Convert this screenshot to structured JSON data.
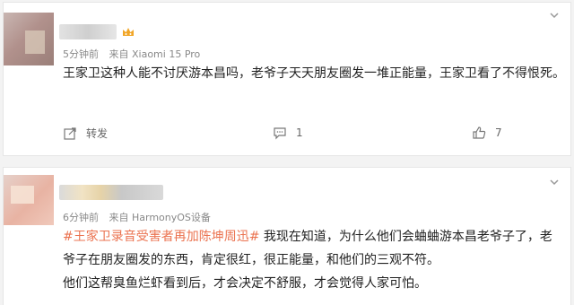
{
  "post1": {
    "time": "5分钟前",
    "source": "来自 Xiaomi 15 Pro",
    "text": "王家卫这种人能不讨厌游本昌吗，老爷子天天朋友圈发一堆正能量，王家卫看了不得恨死。",
    "actions": {
      "repost_label": "转发",
      "comment_count": "1",
      "like_count": "7"
    }
  },
  "post2": {
    "time": "6分钟前",
    "source": "来自 HarmonyOS设备",
    "topic": "#王家卫录音受害者再加陈坤周迅#",
    "text_line1": " 我现在知道，为什么他们会蛐蛐游本昌老爷子了，老",
    "text_line2": "爷子在朋友圈发的东西，肯定很红，很正能量，和他们的三观不符。",
    "text_line3": "他们这帮臭鱼烂虾看到后，才会决定不舒服，才会觉得人家可怕。"
  },
  "colors": {
    "topic": "#eb7350",
    "crown": "#f1a628"
  },
  "icons": [
    "crown-icon",
    "chevron-down-icon",
    "repost-icon",
    "comment-icon",
    "like-icon"
  ]
}
